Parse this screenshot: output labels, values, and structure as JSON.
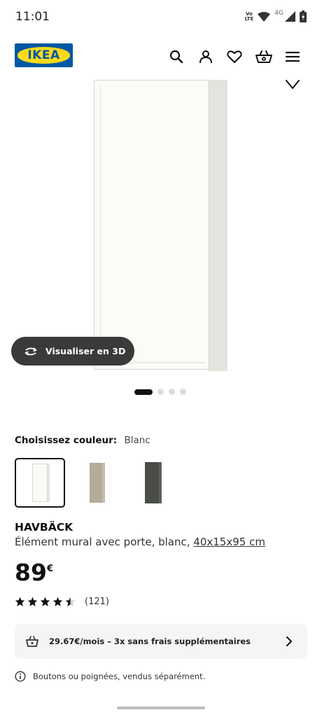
{
  "status_bar": {
    "time": "11:01",
    "network_label": "4G",
    "volte_top": "Vo",
    "volte_bottom": "LTE"
  },
  "header": {
    "logo_text": "IKEA",
    "brand_colors": {
      "blue": "#0058a3",
      "yellow": "#ffda1a"
    },
    "icons": [
      "search-icon",
      "account-icon",
      "favorites-icon",
      "cart-icon",
      "menu-icon"
    ]
  },
  "gallery": {
    "view_3d_label": "Visualiser en 3D",
    "dot_count": 4,
    "active_dot": 0
  },
  "color_picker": {
    "label": "Choisissez couleur:",
    "selected_value": "Blanc",
    "options": [
      {
        "name": "white",
        "color": "#fafaf6",
        "selected": true
      },
      {
        "name": "beige",
        "color": "#b4aa99",
        "selected": false
      },
      {
        "name": "dark-grey",
        "color": "#4a4d48",
        "selected": false
      }
    ]
  },
  "product": {
    "name": "HAVBÄCK",
    "description": "Élément mural avec porte, blanc,",
    "dimensions": "40x15x95 cm",
    "price_integer": "89",
    "price_currency": "€",
    "rating": 4.5,
    "max_rating": 5,
    "review_count": "(121)"
  },
  "installment": {
    "text": "29.67€/mois – 3x sans frais supplémentaires"
  },
  "notice": {
    "text": "Boutons ou poignées, vendus séparément."
  }
}
